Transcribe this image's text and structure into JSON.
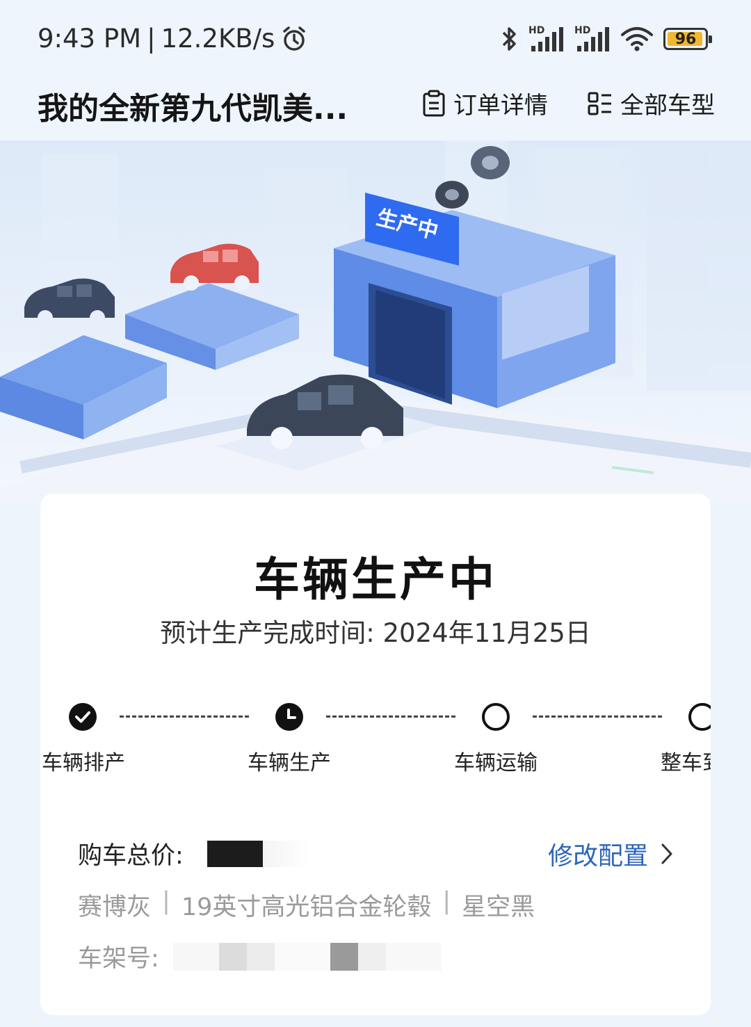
{
  "status_bar": {
    "time": "9:43 PM",
    "net_speed": "12.2KB/s",
    "signal_badge_1": "HD",
    "signal_badge_2": "HD",
    "battery_level": "96",
    "battery_fraction": 0.96,
    "icons": [
      "alarm-icon",
      "bluetooth-icon",
      "signal-icon",
      "signal-icon",
      "wifi-icon",
      "battery-icon"
    ]
  },
  "header": {
    "title": "我的全新第九代凯美...",
    "order_detail_label": "订单详情",
    "all_models_label": "全部车型"
  },
  "hero": {
    "sign_text": "生产中"
  },
  "card": {
    "status_title": "车辆生产中",
    "eta_label": "预计生产完成时间:",
    "eta_value": "2024年11月25日",
    "steps": [
      {
        "label": "车辆排产",
        "state": "done"
      },
      {
        "label": "车辆生产",
        "state": "current"
      },
      {
        "label": "车辆运输",
        "state": "pending"
      },
      {
        "label": "整车到",
        "state": "pending"
      }
    ],
    "price_label": "购车总价:",
    "modify_label": "修改配置",
    "config": [
      "赛博灰",
      "19英寸高光铝合金轮毂",
      "星空黑"
    ],
    "config_separator": "|",
    "vin_label": "车架号:"
  },
  "colors": {
    "accent_blue": "#2d66b8",
    "sign_blue": "#2f6bf0",
    "building_blue": "#6b95ea",
    "battery_yellow": "#f0b731"
  }
}
